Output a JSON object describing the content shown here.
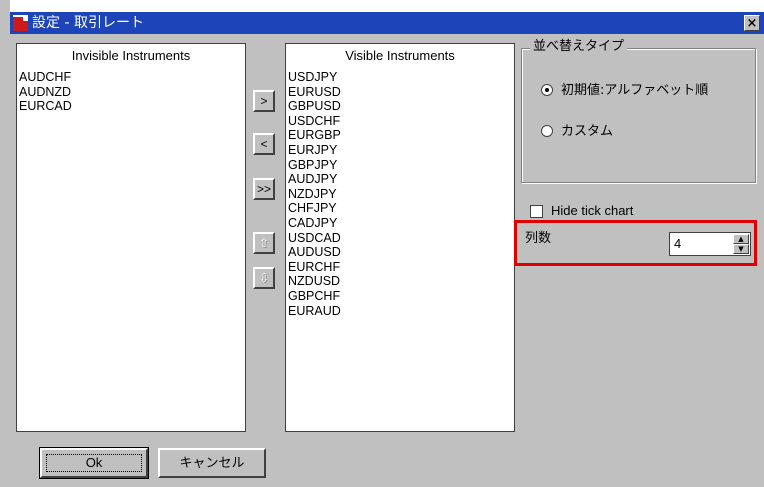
{
  "window": {
    "title": "設定 - 取引レート",
    "close_glyph": "×"
  },
  "invisible": {
    "header": "Invisible Instruments",
    "items": [
      "AUDCHF",
      "AUDNZD",
      "EURCAD"
    ]
  },
  "visible": {
    "header": "Visible Instruments",
    "items": [
      "USDJPY",
      "EURUSD",
      "GBPUSD",
      "USDCHF",
      "EURGBP",
      "EURJPY",
      "GBPJPY",
      "AUDJPY",
      "NZDJPY",
      "CHFJPY",
      "CADJPY",
      "USDCAD",
      "AUDUSD",
      "EURCHF",
      "NZDUSD",
      "GBPCHF",
      "EURAUD"
    ]
  },
  "transfer": {
    "add": ">",
    "remove": "<",
    "add_all": ">>",
    "move_up": "⇧",
    "move_down": "⇩"
  },
  "sort": {
    "legend": "並べ替えタイプ",
    "options": [
      {
        "label": "初期値:アルファベット順",
        "selected": true
      },
      {
        "label": "カスタム",
        "selected": false
      }
    ]
  },
  "hide_tick": {
    "label": "Hide tick chart",
    "checked": false
  },
  "columns": {
    "label": "列数",
    "value": "4"
  },
  "buttons": {
    "ok": "Ok",
    "cancel": "キャンセル"
  },
  "colors": {
    "title_bar": "#1d44b8",
    "highlight": "#e00000",
    "face": "#c0c0c0"
  }
}
